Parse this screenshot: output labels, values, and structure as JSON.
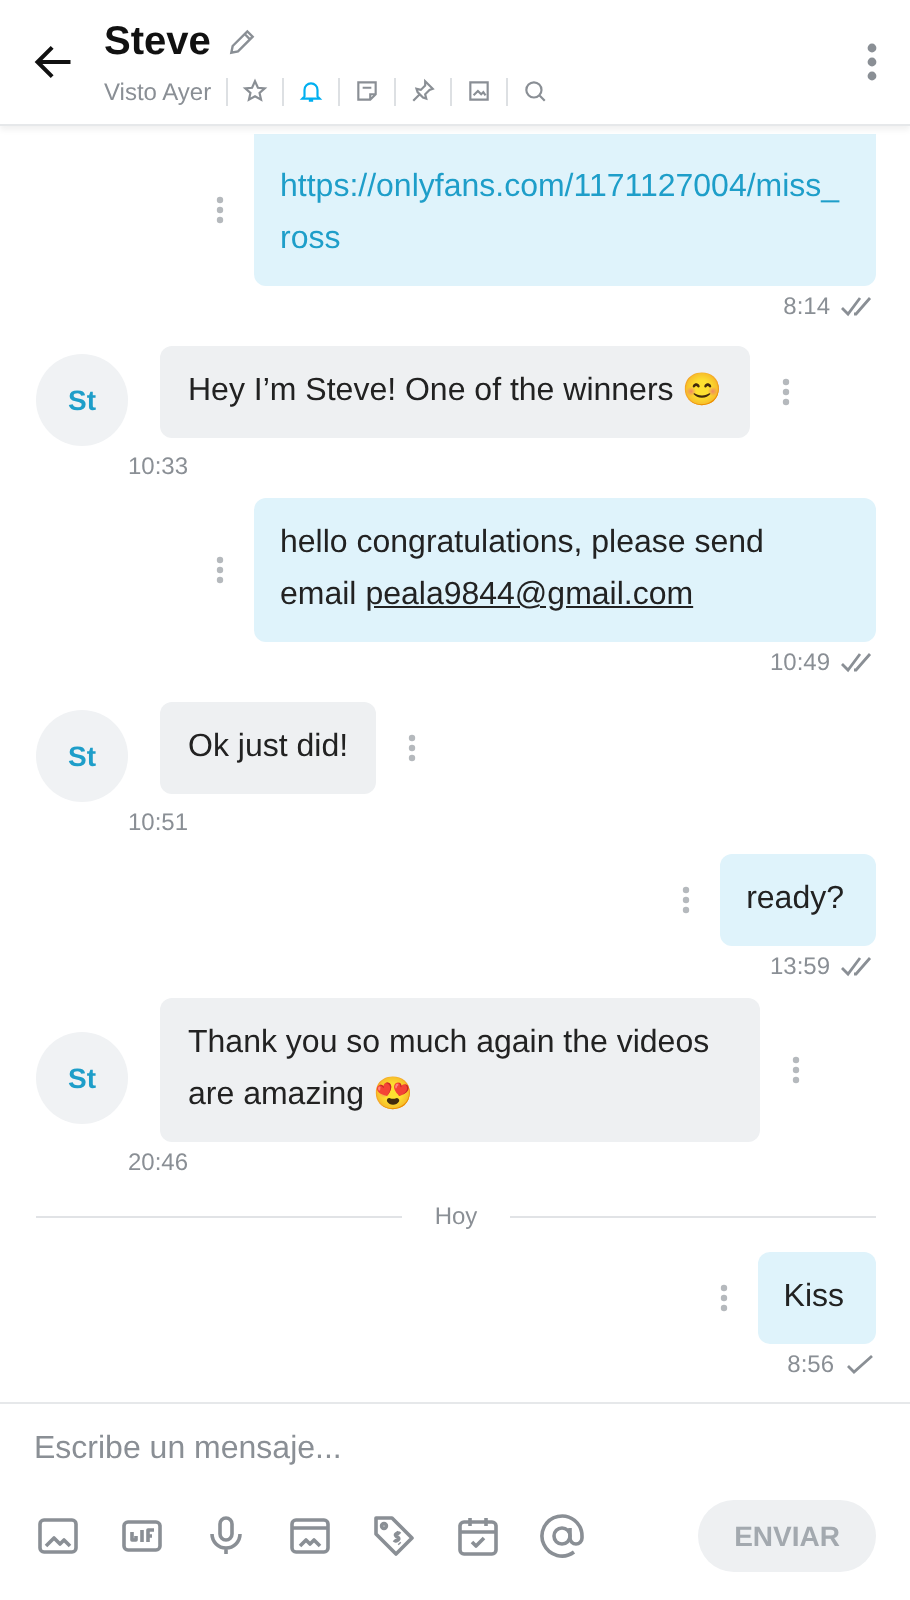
{
  "header": {
    "name": "Steve",
    "status": "Visto Ayer",
    "tools": [
      {
        "kind": "star",
        "active": false
      },
      {
        "kind": "bell",
        "active": true
      },
      {
        "kind": "note",
        "active": false
      },
      {
        "kind": "pin",
        "active": false
      },
      {
        "kind": "image",
        "active": false
      },
      {
        "kind": "search",
        "active": false
      }
    ]
  },
  "messages": [
    {
      "kind": "outgoing",
      "link": "https://onlyfans.com/1171127004/miss_ross",
      "time": "8:14",
      "read": true
    },
    {
      "kind": "incoming",
      "avatar": "St",
      "text": "Hey I’m Steve! One of the winners 😊",
      "time": "10:33"
    },
    {
      "kind": "outgoing",
      "text": "hello congratulations, please send email",
      "email": "peala9844@gmail.com",
      "time": "10:49",
      "read": true
    },
    {
      "kind": "incoming",
      "avatar": "St",
      "text": "Ok just did!",
      "time": "10:51"
    },
    {
      "kind": "outgoing",
      "text": "ready?",
      "time": "13:59",
      "read": true
    },
    {
      "kind": "incoming",
      "avatar": "St",
      "text": "Thank you so much again the videos are amazing 😍",
      "time": "20:46"
    },
    {
      "kind": "divider",
      "text": "Hoy"
    },
    {
      "kind": "outgoing",
      "text": "Kiss",
      "time": "8:56",
      "read": false
    }
  ],
  "composer": {
    "placeholder": "Escribe un mensaje...",
    "tools": [
      {
        "kind": "image"
      },
      {
        "kind": "gif"
      },
      {
        "kind": "mic"
      },
      {
        "kind": "gallery"
      },
      {
        "kind": "price-tag"
      },
      {
        "kind": "calendar"
      },
      {
        "kind": "mention"
      }
    ],
    "send": {
      "label": "ENVIAR",
      "disabled": true
    }
  }
}
